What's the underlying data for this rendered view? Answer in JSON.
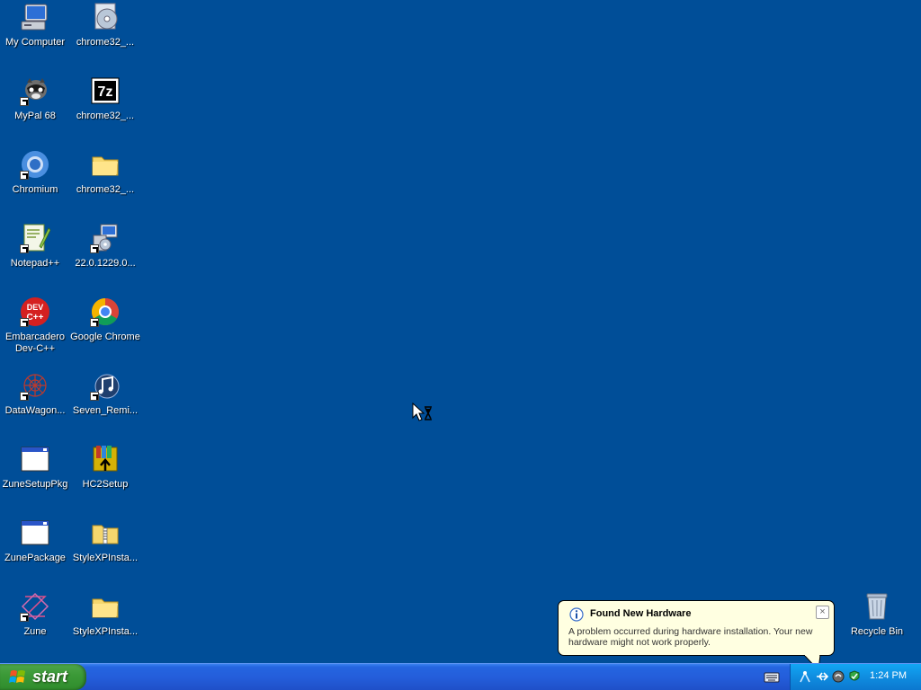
{
  "desktop": {
    "background_color": "#004e98",
    "icons": [
      {
        "label": "My Computer",
        "icon": "my-computer-icon"
      },
      {
        "label": "chrome32_...",
        "icon": "cd-installer-icon"
      },
      {
        "label": "MyPal 68",
        "icon": "raccoon-browser-icon"
      },
      {
        "label": "chrome32_...",
        "icon": "7zip-archive-icon"
      },
      {
        "label": "Chromium",
        "icon": "chromium-icon"
      },
      {
        "label": "chrome32_...",
        "icon": "folder-icon"
      },
      {
        "label": "Notepad++",
        "icon": "notepad-plus-icon"
      },
      {
        "label": "22.0.1229.0...",
        "icon": "setup-package-icon"
      },
      {
        "label": "Embarcadero Dev-C++",
        "icon": "devcpp-icon"
      },
      {
        "label": "Google Chrome",
        "icon": "chrome-icon"
      },
      {
        "label": "DataWagon...",
        "icon": "datawagon-icon"
      },
      {
        "label": "Seven_Remi...",
        "icon": "music-file-icon"
      },
      {
        "label": "ZuneSetupPkg",
        "icon": "application-window-icon"
      },
      {
        "label": "HC2Setup",
        "icon": "winrar-installer-icon"
      },
      {
        "label": "ZunePackage",
        "icon": "application-window-icon"
      },
      {
        "label": "StyleXPInsta...",
        "icon": "zip-folder-icon"
      },
      {
        "label": "Zune",
        "icon": "zune-icon"
      },
      {
        "label": "StyleXPInsta...",
        "icon": "folder-icon"
      }
    ],
    "recycle_bin": {
      "label": "Recycle Bin",
      "icon": "recycle-bin-icon"
    }
  },
  "taskbar": {
    "start_label": "start",
    "tray": {
      "icons": [
        "network-icon",
        "usb-device-icon",
        "volume-icon",
        "security-icon"
      ],
      "clock": "1:24 PM"
    }
  },
  "balloon": {
    "title": "Found New Hardware",
    "message": "A problem occurred during hardware installation. Your new hardware might not work properly.",
    "close_label": "×"
  }
}
